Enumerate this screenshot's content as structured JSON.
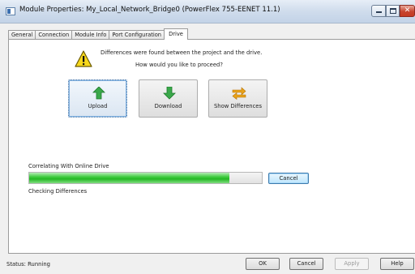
{
  "window": {
    "title": "Module Properties: My_Local_Network_Bridge0 (PowerFlex 755-EENET 11.1)",
    "close_glyph": "✕"
  },
  "tabs": [
    {
      "label": "General",
      "active": false
    },
    {
      "label": "Connection",
      "active": false
    },
    {
      "label": "Module Info",
      "active": false
    },
    {
      "label": "Port Configuration",
      "active": false
    },
    {
      "label": "Drive",
      "active": true
    }
  ],
  "drive": {
    "message_line1": "Differences were found between the project and the drive.",
    "message_line2": "How would you like to proceed?",
    "upload_label": "Upload",
    "download_label": "Download",
    "show_differences_label": "Show Differences",
    "upload_icon": "green-up-arrow-icon",
    "download_icon": "green-down-arrow-icon",
    "show_differences_icon": "orange-swap-arrows-icon"
  },
  "progress": {
    "title": "Correlating With Online Drive",
    "fraction": 0.86,
    "cancel_label": "Cancel",
    "detail": "Checking Differences"
  },
  "footer": {
    "status": "Status:  Running",
    "ok_label": "OK",
    "cancel_label": "Cancel",
    "apply_label": "Apply",
    "help_label": "Help"
  },
  "colors": {
    "progress_green": "#2ec02e",
    "warning_yellow": "#f7d81c",
    "arrow_green": "#3aa84a",
    "arrow_orange": "#e8a21a"
  }
}
